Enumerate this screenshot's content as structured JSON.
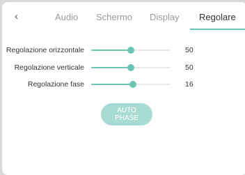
{
  "tabs": [
    {
      "label": "Audio"
    },
    {
      "label": "Schermo"
    },
    {
      "label": "Display"
    },
    {
      "label": "Regolare",
      "active": true
    }
  ],
  "back_icon": "chevron-left-icon",
  "settings": [
    {
      "label": "Regolazione orizzontale",
      "value": "50",
      "level": 0.5
    },
    {
      "label": "Regolazione verticale",
      "value": "50",
      "level": 0.5
    },
    {
      "label": "Regolazione fase",
      "value": "16",
      "level": 0.53
    }
  ],
  "auto_phase": {
    "line1": "AUTO",
    "line2": "PHASE"
  },
  "colors": {
    "accent": "#6cc5b4",
    "button": "#a8dcd2",
    "background": "#d9d9d9"
  }
}
